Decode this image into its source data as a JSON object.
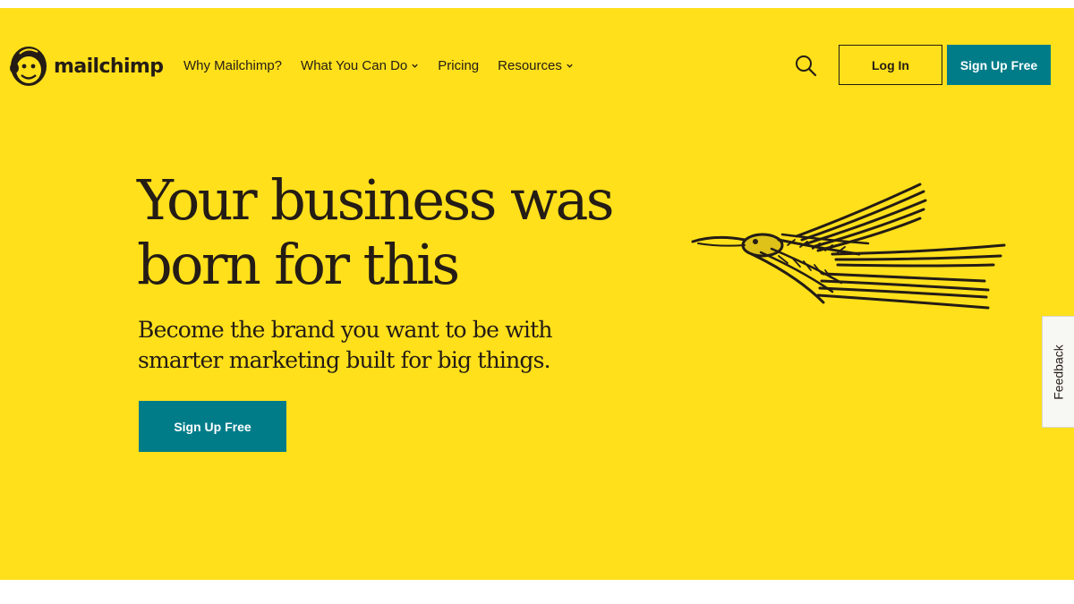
{
  "brand": {
    "name": "mailchimp"
  },
  "colors": {
    "background": "#FFE01B",
    "accent": "#007C89",
    "text": "#241C15"
  },
  "nav": {
    "items": [
      {
        "label": "Why Mailchimp?",
        "dropdown": false
      },
      {
        "label": "What You Can Do",
        "dropdown": true
      },
      {
        "label": "Pricing",
        "dropdown": false
      },
      {
        "label": "Resources",
        "dropdown": true
      }
    ]
  },
  "header": {
    "search_icon": "search-icon",
    "login_label": "Log In",
    "signup_label": "Sign Up Free"
  },
  "hero": {
    "headline_line1": "Your business was",
    "headline_line2": "born for this",
    "subhead_line1": "Become the brand you want to be with",
    "subhead_line2": "smarter marketing built for big things.",
    "cta_label": "Sign Up Free",
    "illustration": "bird-illustration"
  },
  "feedback": {
    "label": "Feedback"
  }
}
